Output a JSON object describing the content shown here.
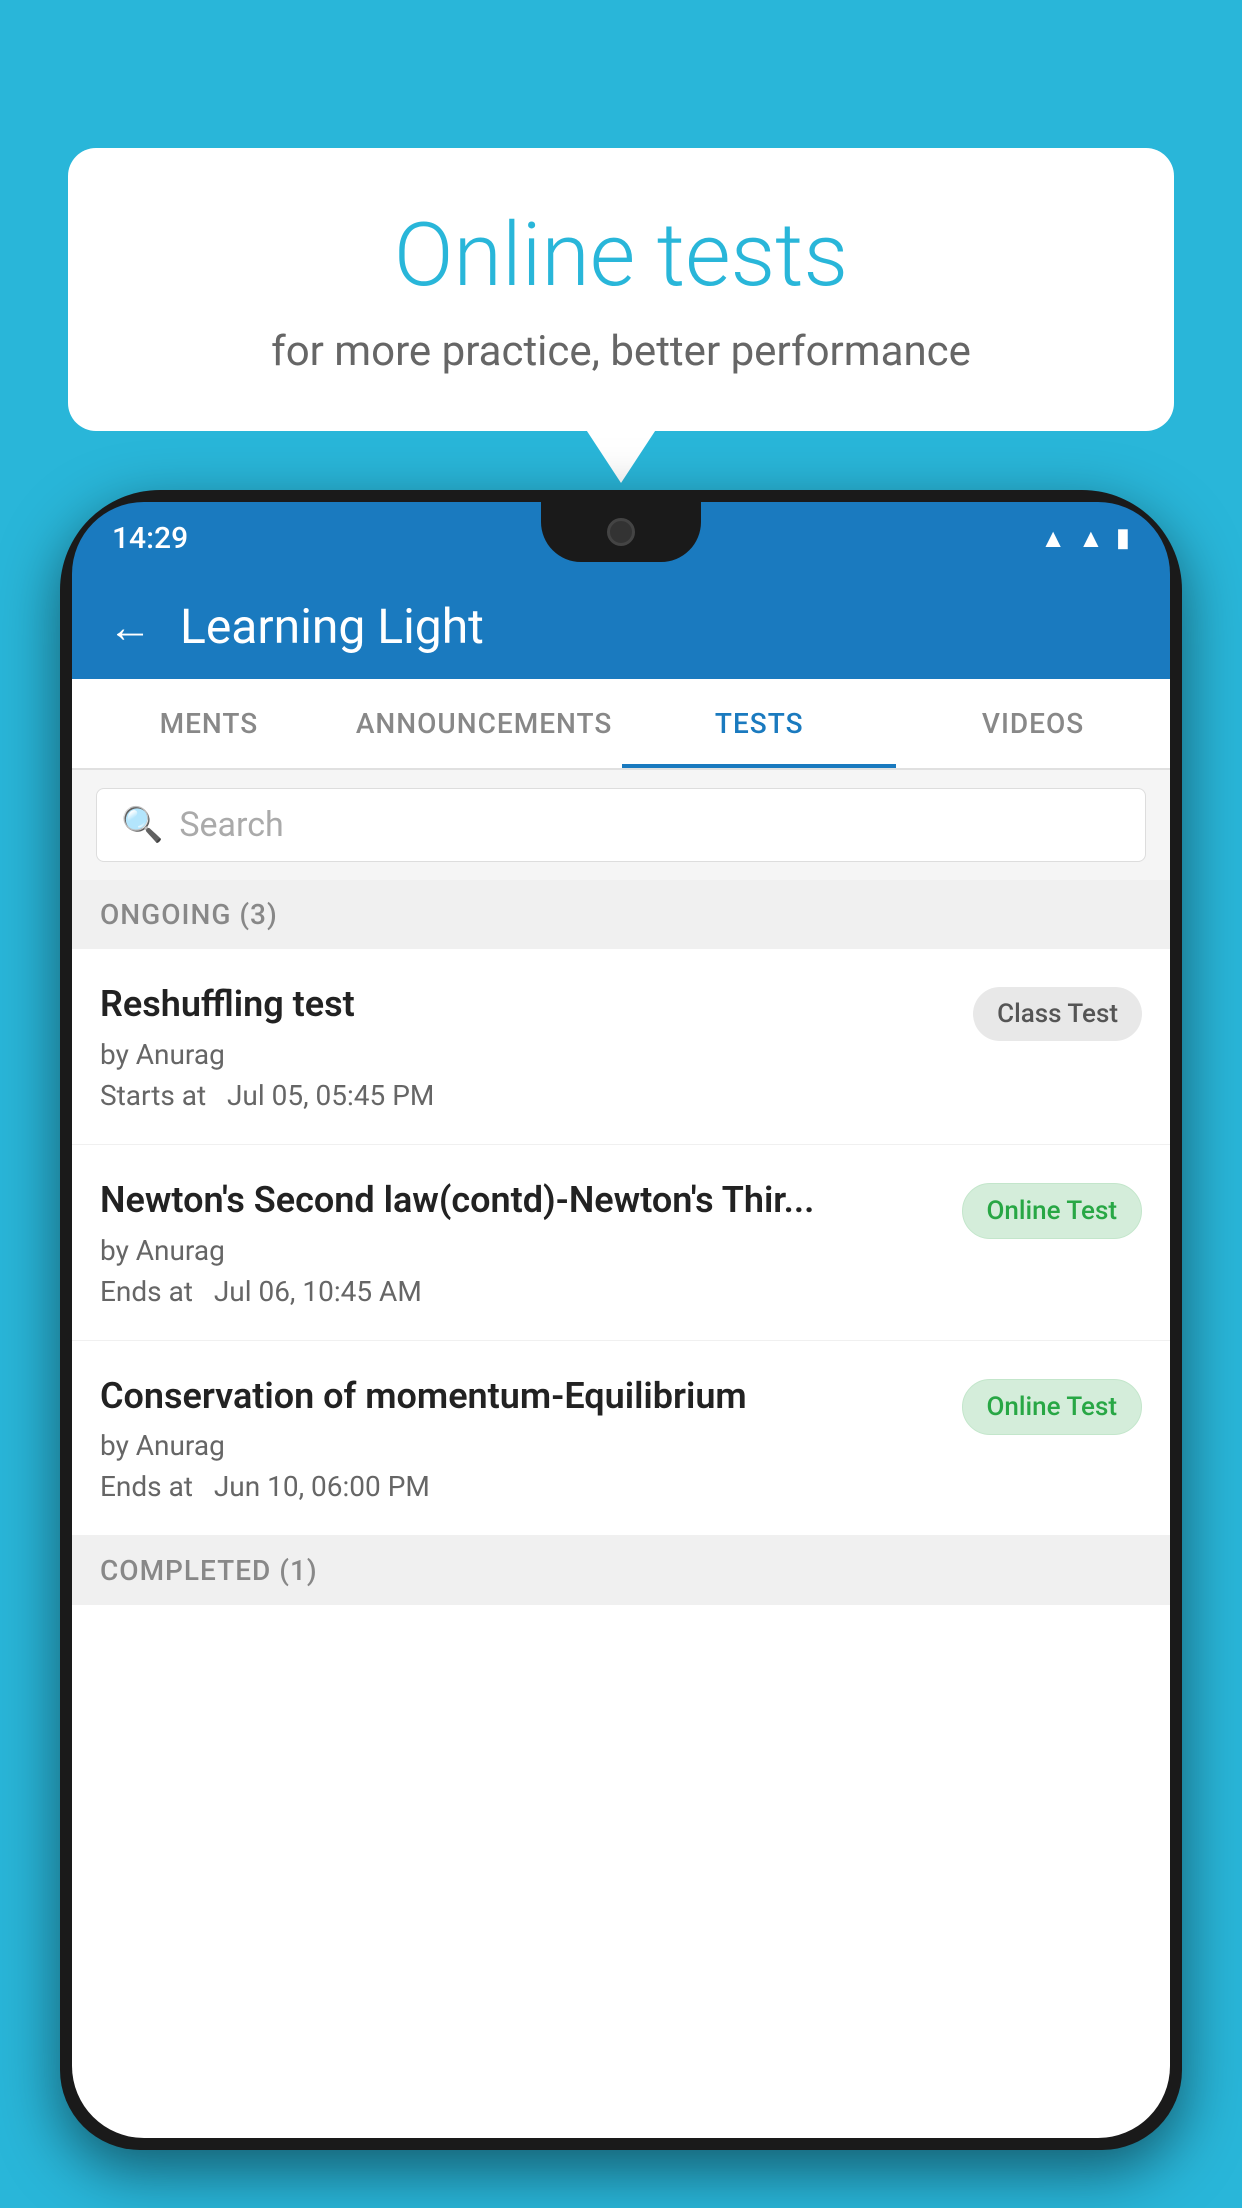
{
  "background": {
    "color": "#29B6D9"
  },
  "speech_bubble": {
    "title": "Online tests",
    "subtitle": "for more practice, better performance"
  },
  "phone": {
    "status_bar": {
      "time": "14:29",
      "icons": [
        "wifi",
        "signal",
        "battery"
      ]
    },
    "app_header": {
      "back_label": "←",
      "title": "Learning Light"
    },
    "tabs": [
      {
        "label": "MENTS",
        "active": false
      },
      {
        "label": "ANNOUNCEMENTS",
        "active": false
      },
      {
        "label": "TESTS",
        "active": true
      },
      {
        "label": "VIDEOS",
        "active": false
      }
    ],
    "search": {
      "placeholder": "Search"
    },
    "section_ongoing": {
      "label": "ONGOING (3)"
    },
    "tests": [
      {
        "name": "Reshuffling test",
        "author": "by Anurag",
        "time_label": "Starts at",
        "time": "Jul 05, 05:45 PM",
        "badge": "Class Test",
        "badge_type": "class"
      },
      {
        "name": "Newton's Second law(contd)-Newton's Thir...",
        "author": "by Anurag",
        "time_label": "Ends at",
        "time": "Jul 06, 10:45 AM",
        "badge": "Online Test",
        "badge_type": "online"
      },
      {
        "name": "Conservation of momentum-Equilibrium",
        "author": "by Anurag",
        "time_label": "Ends at",
        "time": "Jun 10, 06:00 PM",
        "badge": "Online Test",
        "badge_type": "online"
      }
    ],
    "section_completed": {
      "label": "COMPLETED (1)"
    }
  }
}
